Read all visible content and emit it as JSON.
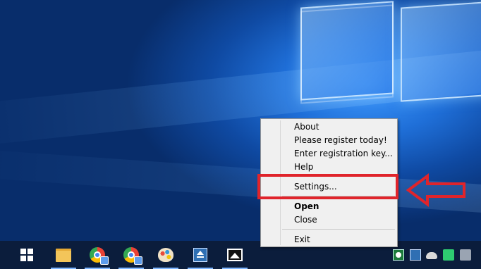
{
  "context_menu": {
    "items": [
      {
        "label": "About"
      },
      {
        "label": "Please register today!"
      },
      {
        "label": "Enter registration key..."
      },
      {
        "label": "Help"
      },
      {
        "label": "Settings..."
      },
      {
        "label": "Open"
      },
      {
        "label": "Close"
      },
      {
        "label": "Exit"
      }
    ]
  },
  "annotation": {
    "highlight_color": "#e0242b",
    "highlighted_item": "Settings..."
  },
  "taskbar": {
    "icons": [
      {
        "name": "store-icon"
      },
      {
        "name": "file-explorer-icon"
      },
      {
        "name": "chrome-icon"
      },
      {
        "name": "chrome-profile-icon"
      },
      {
        "name": "paint-icon"
      },
      {
        "name": "eject-icon"
      },
      {
        "name": "photos-icon"
      }
    ],
    "tray_icons": [
      {
        "name": "app-tray-icon"
      },
      {
        "name": "eject-tray-icon"
      },
      {
        "name": "cloud-tray-icon"
      },
      {
        "name": "security-tray-icon"
      },
      {
        "name": "device-tray-icon"
      }
    ]
  }
}
